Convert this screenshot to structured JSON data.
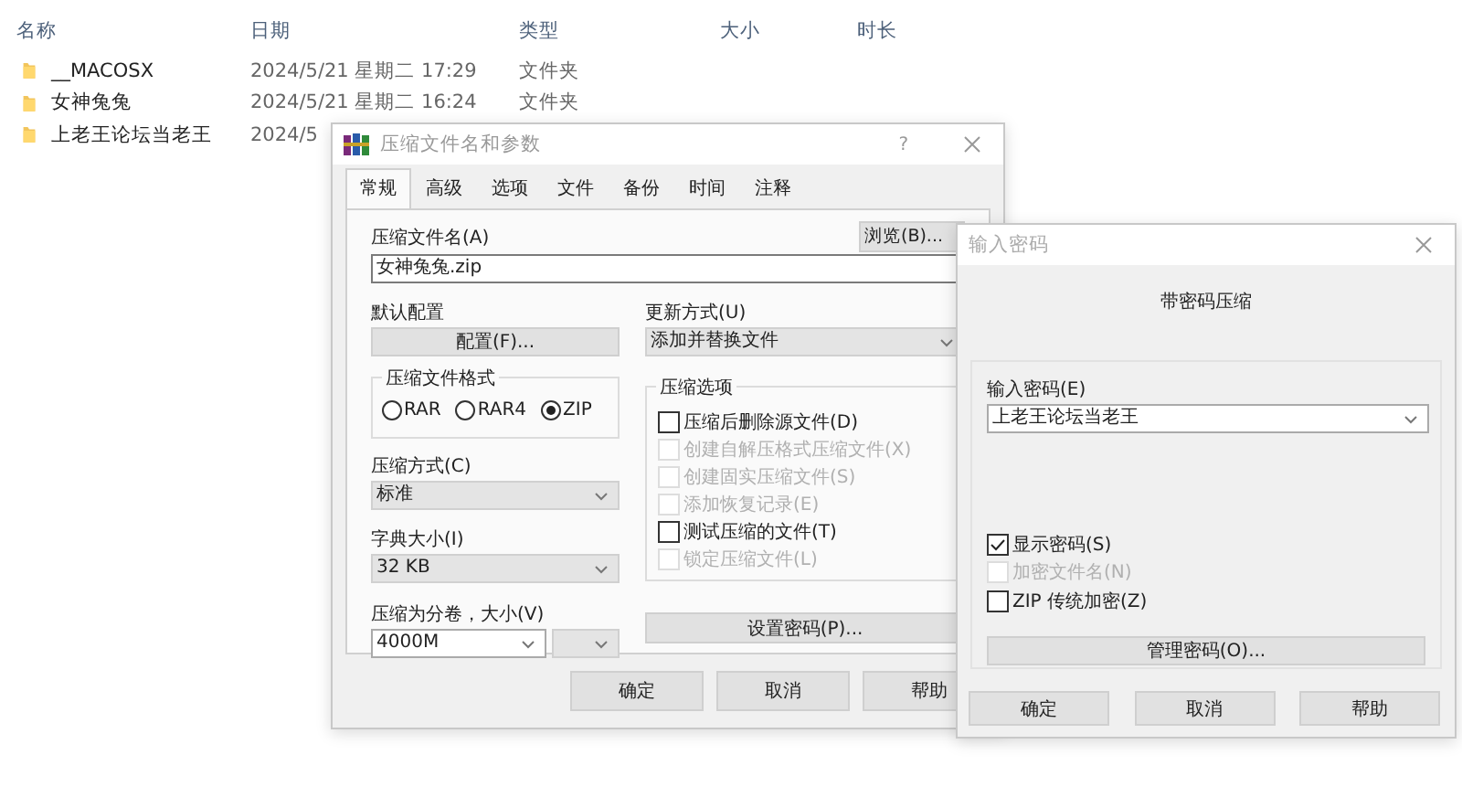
{
  "explorer": {
    "columns": [
      "名称",
      "日期",
      "类型",
      "大小",
      "时长"
    ],
    "rows": [
      {
        "name": "__MACOSX",
        "date": "2024/5/21 星期二 17:29",
        "type": "文件夹"
      },
      {
        "name": "女神兔兔",
        "date": "2024/5/21 星期二 16:24",
        "type": "文件夹"
      },
      {
        "name": "上老王论坛当老王",
        "date": "2024/5"
      }
    ]
  },
  "archive_dialog": {
    "title": "压缩文件名和参数",
    "help": "?",
    "tabs": [
      {
        "label": "常规",
        "selected": true
      },
      {
        "label": "高级",
        "selected": false
      },
      {
        "label": "选项",
        "selected": false
      },
      {
        "label": "文件",
        "selected": false
      },
      {
        "label": "备份",
        "selected": false
      },
      {
        "label": "时间",
        "selected": false
      },
      {
        "label": "注释",
        "selected": false
      }
    ],
    "archive_name": {
      "label": "压缩文件名(A)",
      "value": "女神兔兔.zip",
      "browse": "浏览(B)..."
    },
    "profile": {
      "label": "默认配置",
      "button": "配置(F)..."
    },
    "update_mode": {
      "label": "更新方式(U)",
      "value": "添加并替换文件"
    },
    "format": {
      "label": "压缩文件格式",
      "options": [
        {
          "label": "RAR",
          "selected": false
        },
        {
          "label": "RAR4",
          "selected": false
        },
        {
          "label": "ZIP",
          "selected": true
        }
      ]
    },
    "method": {
      "label": "压缩方式(C)",
      "value": "标准"
    },
    "dictionary": {
      "label": "字典大小(I)",
      "value": "32 KB"
    },
    "volumes": {
      "label": "压缩为分卷，大小(V)",
      "value": "4000M"
    },
    "options": {
      "label": "压缩选项",
      "items": [
        {
          "label": "压缩后删除源文件(D)",
          "checked": false,
          "disabled": false
        },
        {
          "label": "创建自解压格式压缩文件(X)",
          "checked": false,
          "disabled": true
        },
        {
          "label": "创建固实压缩文件(S)",
          "checked": false,
          "disabled": true
        },
        {
          "label": "添加恢复记录(E)",
          "checked": false,
          "disabled": true
        },
        {
          "label": "测试压缩的文件(T)",
          "checked": false,
          "disabled": false
        },
        {
          "label": "锁定压缩文件(L)",
          "checked": false,
          "disabled": true
        }
      ]
    },
    "password_button": "设置密码(P)...",
    "buttons": [
      "确定",
      "取消",
      "帮助"
    ]
  },
  "password_dialog": {
    "title": "输入密码",
    "heading": "带密码压缩",
    "password": {
      "label": "输入密码(E)",
      "value": "上老王论坛当老王"
    },
    "options": [
      {
        "label": "显示密码(S)",
        "checked": true,
        "disabled": false
      },
      {
        "label": "加密文件名(N)",
        "checked": false,
        "disabled": true
      },
      {
        "label": "ZIP 传统加密(Z)",
        "checked": false,
        "disabled": false
      }
    ],
    "manage_button": "管理密码(O)...",
    "buttons": [
      "确定",
      "取消",
      "帮助"
    ]
  }
}
